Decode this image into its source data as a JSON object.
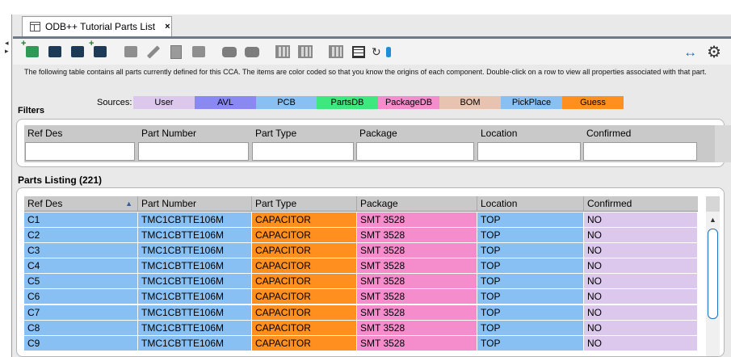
{
  "tab": {
    "title": "ODB++ Tutorial Parts List",
    "close": "×"
  },
  "toolbar": {
    "icons": [
      "add-part-icon",
      "add-parts-icon",
      "import-icon",
      "database-add-icon",
      "edit-part-icon",
      "pencil-icon",
      "copy-icon",
      "move-icon",
      "comment-icon",
      "comment-add-icon",
      "grid-edit-icon",
      "grid-view-icon",
      "layout-icon",
      "table-icon",
      "sync-database-icon",
      "fit-width-icon",
      "gear-icon"
    ],
    "fit_width": "↔",
    "settings": "⚙"
  },
  "description": "The following table contains all parts currently defined for this CCA. The items are color coded so that you know the origins of each component. Double-click on a row to view all properties associated with that part.",
  "filters": {
    "title": "Filters",
    "sources_label": "Sources:",
    "sources": [
      {
        "label": "User",
        "color": "#dcc8ec"
      },
      {
        "label": "AVL",
        "color": "#8a88f2"
      },
      {
        "label": "PCB",
        "color": "#88c0f4"
      },
      {
        "label": "PartsDB",
        "color": "#3ee87e"
      },
      {
        "label": "PackageDB",
        "color": "#f58ccc"
      },
      {
        "label": "BOM",
        "color": "#e8c4b0"
      },
      {
        "label": "PickPlace",
        "color": "#88c0f4"
      },
      {
        "label": "Guess",
        "color": "#ff9020"
      }
    ],
    "columns": [
      "Ref Des",
      "Part Number",
      "Part Type",
      "Package",
      "Location",
      "Confirmed"
    ]
  },
  "parts": {
    "title": "Parts Listing (221)",
    "columns": [
      "Ref Des",
      "Part Number",
      "Part Type",
      "Package",
      "Location",
      "Confirmed"
    ],
    "sort_indicator": "▲",
    "column_colors": [
      "#88c0f4",
      "#88c0f4",
      "#ff9020",
      "#f58ccc",
      "#88c0f4",
      "#dcc8ec"
    ],
    "rows": [
      [
        "C1",
        "TMC1CBTTE106M",
        "CAPACITOR",
        "SMT 3528",
        "TOP",
        "NO"
      ],
      [
        "C2",
        "TMC1CBTTE106M",
        "CAPACITOR",
        "SMT 3528",
        "TOP",
        "NO"
      ],
      [
        "C3",
        "TMC1CBTTE106M",
        "CAPACITOR",
        "SMT 3528",
        "TOP",
        "NO"
      ],
      [
        "C4",
        "TMC1CBTTE106M",
        "CAPACITOR",
        "SMT 3528",
        "TOP",
        "NO"
      ],
      [
        "C5",
        "TMC1CBTTE106M",
        "CAPACITOR",
        "SMT 3528",
        "TOP",
        "NO"
      ],
      [
        "C6",
        "TMC1CBTTE106M",
        "CAPACITOR",
        "SMT 3528",
        "TOP",
        "NO"
      ],
      [
        "C7",
        "TMC1CBTTE106M",
        "CAPACITOR",
        "SMT 3528",
        "TOP",
        "NO"
      ],
      [
        "C8",
        "TMC1CBTTE106M",
        "CAPACITOR",
        "SMT 3528",
        "TOP",
        "NO"
      ],
      [
        "C9",
        "TMC1CBTTE106M",
        "CAPACITOR",
        "SMT 3528",
        "TOP",
        "NO"
      ]
    ],
    "scroll_up": "▲"
  }
}
